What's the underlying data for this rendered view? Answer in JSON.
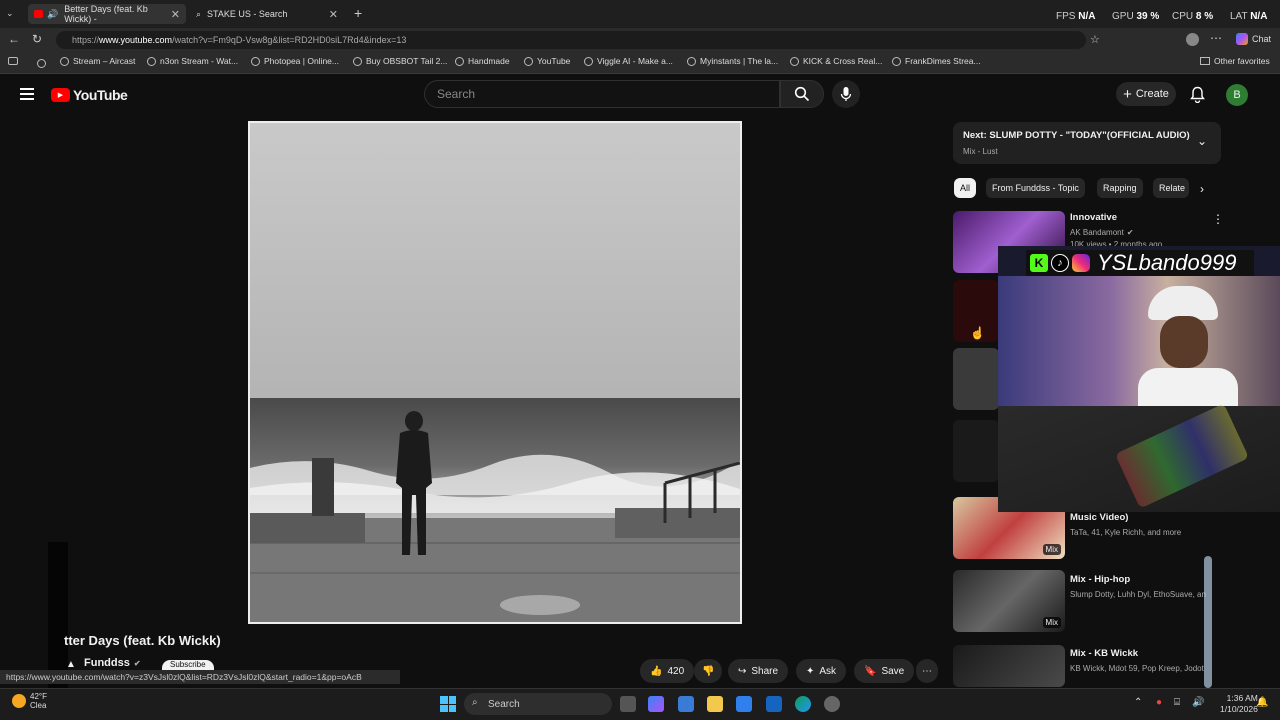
{
  "browser": {
    "tabs": [
      {
        "title": "Better Days (feat. Kb Wickk) -"
      },
      {
        "title": "STAKE US - Search"
      }
    ],
    "url_prefix": "https://",
    "url_host": "www.youtube.com",
    "url_rest": "/watch?v=Fm9qD-Vsw8g&list=RD2HD0siL7Rd4&index=13",
    "bookmarks": [
      "Stream – Aircast",
      "n3on Stream - Wat...",
      "Photopea | Online...",
      "Buy OBSBOT Tail 2...",
      "Handmade",
      "YouTube",
      "Viggle AI - Make a...",
      "Myinstants | The la...",
      "KICK & Cross Real...",
      "FrankDimes Strea..."
    ],
    "other_favorites": "Other favorites",
    "chat": "Chat",
    "status_url": "https://www.youtube.com/watch?v=z3VsJsl0zlQ&list=RDz3VsJsl0zlQ&start_radio=1&pp=oAcB"
  },
  "hud": {
    "fps_label": "FPS",
    "fps_value": "N/A",
    "gpu_label": "GPU",
    "gpu_value": "39 %",
    "cpu_label": "CPU",
    "cpu_value": "8 %",
    "lat_label": "LAT",
    "lat_value": "N/A"
  },
  "youtube": {
    "logo": "YouTube",
    "search_placeholder": "Search",
    "create_label": "Create",
    "avatar_letter": "B",
    "video_title": "tter Days (feat. Kb Wickk)",
    "channel": "Funddss",
    "subscribe": "Subscribe",
    "likes": "420",
    "share": "Share",
    "ask": "Ask",
    "save": "Save"
  },
  "next": {
    "label": "Next:",
    "title": "SLUMP DOTTY - \"TODAY\"(OFFICIAL AUDIO)",
    "sub": "Mix - Lust"
  },
  "chips": [
    "All",
    "From Funddss - Topic",
    "Rapping",
    "Relate"
  ],
  "recs": [
    {
      "title": "Innovative",
      "channel": "AK Bandamont",
      "meta": "10K views • 2 months ago"
    },
    {
      "title": "Music Video)",
      "channel": "TaTa, 41, Kyle Richh, and more",
      "badge": "Mix"
    },
    {
      "title": "Mix - Hip-hop",
      "channel": "Slump Dotty, Luhh Dyl, EthoSuave, and",
      "badge": "Mix"
    },
    {
      "title": "Mix - KB Wickk",
      "channel": "KB Wickk, Mdot 59, Pop Kreep, Jodot",
      "badge": "Mix"
    }
  ],
  "overlay": {
    "handle": "YSLbando999"
  },
  "taskbar": {
    "weather_temp": "42°F",
    "weather_desc": "Clea",
    "search": "Search",
    "time": "1:36 AM",
    "date": "1/10/2026"
  }
}
